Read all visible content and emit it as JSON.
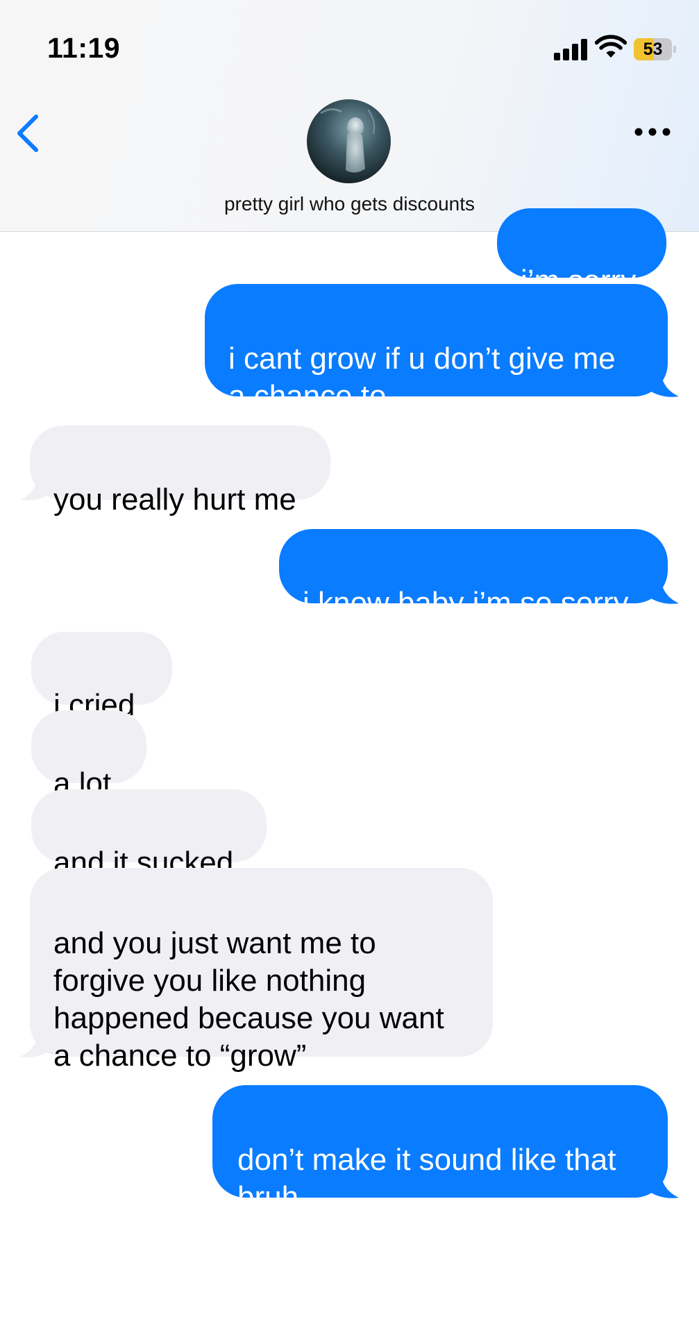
{
  "status_bar": {
    "time": "11:19",
    "battery_percent": "53",
    "battery_level": 0.53,
    "signal_bars": 4,
    "wifi_icon": "wifi-icon",
    "signal_icon": "cellular-signal-icon"
  },
  "header": {
    "contact_name": "pretty girl who gets discounts",
    "back_icon": "chevron-left-icon",
    "more_icon": "ellipsis-icon"
  },
  "colors": {
    "sent_bubble": "#0a7cff",
    "received_bubble": "#efeff4",
    "accent": "#0a7cff"
  },
  "messages": [
    {
      "direction": "sent",
      "text": "i’m sorry"
    },
    {
      "direction": "sent",
      "text": "i cant grow if u don’t give me\na chance to"
    },
    {
      "direction": "received",
      "text": "you really hurt me"
    },
    {
      "direction": "sent",
      "text": "i know baby i’m so sorry"
    },
    {
      "direction": "received",
      "text": "i cried"
    },
    {
      "direction": "received",
      "text": "a lot"
    },
    {
      "direction": "received",
      "text": "and it sucked"
    },
    {
      "direction": "received",
      "text": "and you just want me to\nforgive you like nothing\nhappened because you want\na chance to “grow”"
    },
    {
      "direction": "sent",
      "text": "don’t make it sound like that\nbruh"
    }
  ]
}
